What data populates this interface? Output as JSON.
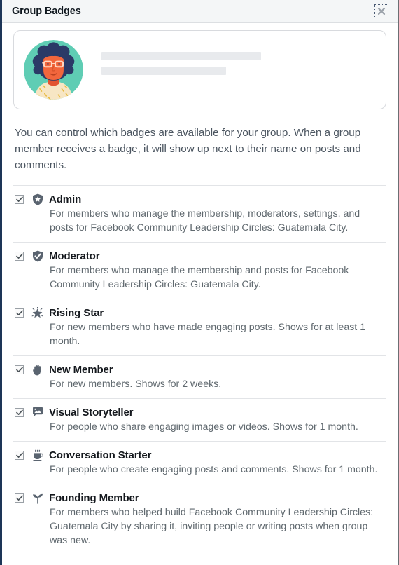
{
  "window": {
    "title": "Group Badges",
    "close_icon": "close-icon"
  },
  "profile": {
    "avatar_icon": "avatar-illustration",
    "name_placeholder": "",
    "subtitle_placeholder": ""
  },
  "intro": {
    "text": "You can control which badges are available for your group. When a group member receives a badge, it will show up next to their name on posts and comments."
  },
  "badges": [
    {
      "name": "Admin",
      "icon": "shield-star-icon",
      "checked": true,
      "description": "For members who manage the membership, moderators, settings, and posts for Facebook Community Leadership Circles: Guatemala City."
    },
    {
      "name": "Moderator",
      "icon": "shield-check-icon",
      "checked": true,
      "description": "For members who manage the membership and posts for Facebook Community Leadership Circles: Guatemala City."
    },
    {
      "name": "Rising Star",
      "icon": "sparkle-star-icon",
      "checked": true,
      "description": "For new members who have made engaging posts. Shows for at least 1 month."
    },
    {
      "name": "New Member",
      "icon": "waving-hand-icon",
      "checked": true,
      "description": "For new members. Shows for 2 weeks."
    },
    {
      "name": "Visual Storyteller",
      "icon": "speech-bubble-photo-icon",
      "checked": true,
      "description": "For people who share engaging images or videos. Shows for 1 month."
    },
    {
      "name": "Conversation Starter",
      "icon": "coffee-cup-icon",
      "checked": true,
      "description": "For people who create engaging posts and comments. Shows for 1 month."
    },
    {
      "name": "Founding Member",
      "icon": "seedling-icon",
      "checked": true,
      "description": "For members who helped build Facebook Community Leadership Circles: Guatemala City by sharing it, inviting people or writing posts when group was new."
    }
  ],
  "colors": {
    "titlebar_bg": "#f4f6f7",
    "window_border_left": "#1d3557",
    "badge_icon": "#5a6470",
    "text_primary": "#14181d",
    "text_secondary": "#60696f",
    "avatar_bg": "#5fcdb4",
    "avatar_hair": "#2b3a67",
    "avatar_skin": "#f2663c",
    "avatar_shirt": "#f7e6c4"
  }
}
